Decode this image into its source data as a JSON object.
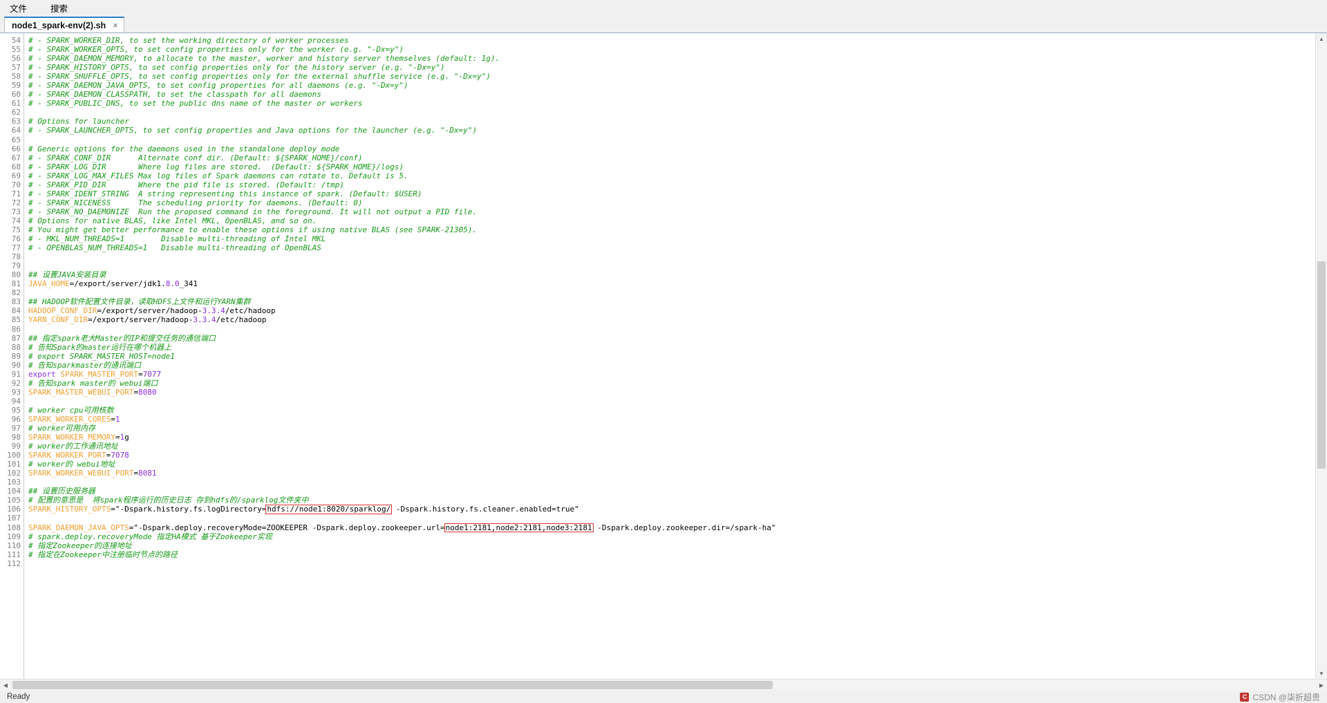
{
  "menubar": {
    "items": [
      {
        "label": "文件"
      },
      {
        "label": "搜索"
      }
    ]
  },
  "tab": {
    "title": "node1_spark-env(2).sh",
    "close": "×"
  },
  "statusbar": {
    "left": "Ready",
    "watermark": "CSDN @柒折超贵",
    "watermark_logo": "C"
  },
  "colors": {
    "comment": "#179a18",
    "variable": "#f0a030",
    "number": "#8a2be2",
    "keyword": "#8a2be2",
    "highlight_box": "#e03030",
    "tab_accent": "#2a7fd4",
    "gutter_text": "#808080"
  },
  "editor": {
    "first_line": 54,
    "lines": [
      {
        "n": 54,
        "segments": [
          {
            "t": "# - SPARK_WORKER_DIR, to set the working directory of worker processes",
            "c": "cmt"
          }
        ]
      },
      {
        "n": 55,
        "segments": [
          {
            "t": "# - SPARK_WORKER_OPTS, to set config properties only for the worker (e.g. \"-Dx=y\")",
            "c": "cmt"
          }
        ]
      },
      {
        "n": 56,
        "segments": [
          {
            "t": "# - SPARK_DAEMON_MEMORY, to allocate to the master, worker and history server themselves (default: 1g).",
            "c": "cmt"
          }
        ]
      },
      {
        "n": 57,
        "segments": [
          {
            "t": "# - SPARK_HISTORY_OPTS, to set config properties only for the history server (e.g. \"-Dx=y\")",
            "c": "cmt"
          }
        ]
      },
      {
        "n": 58,
        "segments": [
          {
            "t": "# - SPARK_SHUFFLE_OPTS, to set config properties only for the external shuffle service (e.g. \"-Dx=y\")",
            "c": "cmt"
          }
        ]
      },
      {
        "n": 59,
        "segments": [
          {
            "t": "# - SPARK_DAEMON_JAVA_OPTS, to set config properties for all daemons (e.g. \"-Dx=y\")",
            "c": "cmt"
          }
        ]
      },
      {
        "n": 60,
        "segments": [
          {
            "t": "# - SPARK_DAEMON_CLASSPATH, to set the classpath for all daemons",
            "c": "cmt"
          }
        ]
      },
      {
        "n": 61,
        "segments": [
          {
            "t": "# - SPARK_PUBLIC_DNS, to set the public dns name of the master or workers",
            "c": "cmt"
          }
        ]
      },
      {
        "n": 62,
        "segments": []
      },
      {
        "n": 63,
        "segments": [
          {
            "t": "# Options for launcher",
            "c": "cmt"
          }
        ]
      },
      {
        "n": 64,
        "segments": [
          {
            "t": "# - SPARK_LAUNCHER_OPTS, to set config properties and Java options for the launcher (e.g. \"-Dx=y\")",
            "c": "cmt"
          }
        ]
      },
      {
        "n": 65,
        "segments": []
      },
      {
        "n": 66,
        "segments": [
          {
            "t": "# Generic options for the daemons used in the standalone deploy mode",
            "c": "cmt"
          }
        ]
      },
      {
        "n": 67,
        "segments": [
          {
            "t": "# - SPARK_CONF_DIR      Alternate conf dir. (Default: ${SPARK_HOME}/conf)",
            "c": "cmt"
          }
        ]
      },
      {
        "n": 68,
        "segments": [
          {
            "t": "# - SPARK_LOG_DIR       Where log files are stored.  (Default: ${SPARK_HOME}/logs)",
            "c": "cmt"
          }
        ]
      },
      {
        "n": 69,
        "segments": [
          {
            "t": "# - SPARK_LOG_MAX_FILES Max log files of Spark daemons can rotate to. Default is 5.",
            "c": "cmt"
          }
        ]
      },
      {
        "n": 70,
        "segments": [
          {
            "t": "# - SPARK_PID_DIR       Where the pid file is stored. (Default: /tmp)",
            "c": "cmt"
          }
        ]
      },
      {
        "n": 71,
        "segments": [
          {
            "t": "# - SPARK_IDENT_STRING  A string representing this instance of spark. (Default: $USER)",
            "c": "cmt"
          }
        ]
      },
      {
        "n": 72,
        "segments": [
          {
            "t": "# - SPARK_NICENESS      The scheduling priority for daemons. (Default: 0)",
            "c": "cmt"
          }
        ]
      },
      {
        "n": 73,
        "segments": [
          {
            "t": "# - SPARK_NO_DAEMONIZE  Run the proposed command in the foreground. It will not output a PID file.",
            "c": "cmt"
          }
        ]
      },
      {
        "n": 74,
        "segments": [
          {
            "t": "# Options for native BLAS, like Intel MKL, OpenBLAS, and so on.",
            "c": "cmt"
          }
        ]
      },
      {
        "n": 75,
        "segments": [
          {
            "t": "# You might get better performance to enable these options if using native BLAS (see SPARK-21305).",
            "c": "cmt"
          }
        ]
      },
      {
        "n": 76,
        "segments": [
          {
            "t": "# - MKL_NUM_THREADS=1        Disable multi-threading of Intel MKL",
            "c": "cmt"
          }
        ]
      },
      {
        "n": 77,
        "segments": [
          {
            "t": "# - OPENBLAS_NUM_THREADS=1   Disable multi-threading of OpenBLAS",
            "c": "cmt"
          }
        ]
      },
      {
        "n": 78,
        "segments": []
      },
      {
        "n": 79,
        "segments": []
      },
      {
        "n": 80,
        "segments": [
          {
            "t": "## 设置JAVA安装目录",
            "c": "cmt"
          }
        ]
      },
      {
        "n": 81,
        "segments": [
          {
            "t": "JAVA_HOME",
            "c": "var"
          },
          {
            "t": "=/export/server/jdk1.",
            "c": "val"
          },
          {
            "t": "8.0",
            "c": "num"
          },
          {
            "t": "_341",
            "c": "val"
          }
        ]
      },
      {
        "n": 82,
        "segments": []
      },
      {
        "n": 83,
        "segments": [
          {
            "t": "## HADOOP软件配置文件目录，读取HDFS上文件和运行YARN集群",
            "c": "cmt"
          }
        ]
      },
      {
        "n": 84,
        "segments": [
          {
            "t": "HADOOP_CONF_DIR",
            "c": "var"
          },
          {
            "t": "=/export/server/hadoop-",
            "c": "val"
          },
          {
            "t": "3.3.4",
            "c": "num"
          },
          {
            "t": "/etc/hadoop",
            "c": "val"
          }
        ]
      },
      {
        "n": 85,
        "segments": [
          {
            "t": "YARN_CONF_DIR",
            "c": "var"
          },
          {
            "t": "=/export/server/hadoop-",
            "c": "val"
          },
          {
            "t": "3.3.4",
            "c": "num"
          },
          {
            "t": "/etc/hadoop",
            "c": "val"
          }
        ]
      },
      {
        "n": 86,
        "segments": []
      },
      {
        "n": 87,
        "segments": [
          {
            "t": "## 指定spark老大Master的IP和提交任务的通信端口",
            "c": "cmt"
          }
        ]
      },
      {
        "n": 88,
        "segments": [
          {
            "t": "# 告知Spark的master运行在哪个机器上",
            "c": "cmt"
          }
        ]
      },
      {
        "n": 89,
        "segments": [
          {
            "t": "# export SPARK_MASTER_HOST=node1",
            "c": "cmt"
          }
        ]
      },
      {
        "n": 90,
        "segments": [
          {
            "t": "# 告知sparkmaster的通讯端口",
            "c": "cmt"
          }
        ]
      },
      {
        "n": 91,
        "segments": [
          {
            "t": "export",
            "c": "kw"
          },
          {
            "t": " ",
            "c": "val"
          },
          {
            "t": "SPARK_MASTER_PORT",
            "c": "var"
          },
          {
            "t": "=",
            "c": "val"
          },
          {
            "t": "7077",
            "c": "num"
          }
        ]
      },
      {
        "n": 92,
        "segments": [
          {
            "t": "# 告知spark master的 webui端口",
            "c": "cmt"
          }
        ]
      },
      {
        "n": 93,
        "segments": [
          {
            "t": "SPARK_MASTER_WEBUI_PORT",
            "c": "var"
          },
          {
            "t": "=",
            "c": "val"
          },
          {
            "t": "8080",
            "c": "num"
          }
        ]
      },
      {
        "n": 94,
        "segments": []
      },
      {
        "n": 95,
        "segments": [
          {
            "t": "# worker cpu可用核数",
            "c": "cmt"
          }
        ]
      },
      {
        "n": 96,
        "segments": [
          {
            "t": "SPARK_WORKER_CORES",
            "c": "var"
          },
          {
            "t": "=",
            "c": "val"
          },
          {
            "t": "1",
            "c": "num"
          }
        ]
      },
      {
        "n": 97,
        "segments": [
          {
            "t": "# worker可用内存",
            "c": "cmt"
          }
        ]
      },
      {
        "n": 98,
        "segments": [
          {
            "t": "SPARK_WORKER_MEMORY",
            "c": "var"
          },
          {
            "t": "=",
            "c": "val"
          },
          {
            "t": "1",
            "c": "num"
          },
          {
            "t": "g",
            "c": "val"
          }
        ]
      },
      {
        "n": 99,
        "segments": [
          {
            "t": "# worker的工作通讯地址",
            "c": "cmt"
          }
        ]
      },
      {
        "n": 100,
        "segments": [
          {
            "t": "SPARK_WORKER_PORT",
            "c": "var"
          },
          {
            "t": "=",
            "c": "val"
          },
          {
            "t": "7078",
            "c": "num"
          }
        ]
      },
      {
        "n": 101,
        "segments": [
          {
            "t": "# worker的 webui地址",
            "c": "cmt"
          }
        ]
      },
      {
        "n": 102,
        "segments": [
          {
            "t": "SPARK_WORKER_WEBUI_PORT",
            "c": "var"
          },
          {
            "t": "=",
            "c": "val"
          },
          {
            "t": "8081",
            "c": "num"
          }
        ]
      },
      {
        "n": 103,
        "segments": []
      },
      {
        "n": 104,
        "segments": [
          {
            "t": "## 设置历史服务器",
            "c": "cmt"
          }
        ]
      },
      {
        "n": 105,
        "segments": [
          {
            "t": "# 配置的意思是  将spark程序运行的历史日志 存到hdfs的/sparklog文件夹中",
            "c": "cmt"
          }
        ]
      },
      {
        "n": 106,
        "segments": [
          {
            "t": "SPARK_HISTORY_OPTS",
            "c": "var"
          },
          {
            "t": "=\"-Dspark.history.fs.logDirectory=",
            "c": "val"
          },
          {
            "t": "hdfs://node1:8020/sparklog/",
            "c": "val",
            "box": true
          },
          {
            "t": " -Dspark.history.fs.cleaner.enabled=true\"",
            "c": "val"
          }
        ]
      },
      {
        "n": 107,
        "segments": []
      },
      {
        "n": 108,
        "segments": [
          {
            "t": "SPARK_DAEMON_JAVA_OPTS",
            "c": "var"
          },
          {
            "t": "=\"-Dspark.deploy.recoveryMode=ZOOKEEPER -Dspark.deploy.zookeeper.url=",
            "c": "val"
          },
          {
            "t": "node1:2181,node2:2181,node3:2181",
            "c": "val",
            "box": true
          },
          {
            "t": " -Dspark.deploy.zookeeper.dir=/spark-ha\"",
            "c": "val"
          }
        ]
      },
      {
        "n": 109,
        "segments": [
          {
            "t": "# spark.deploy.recoveryMode 指定HA模式 基于Zookeeper实现",
            "c": "cmt"
          }
        ]
      },
      {
        "n": 110,
        "segments": [
          {
            "t": "# 指定Zookeeper的连接地址",
            "c": "cmt"
          }
        ]
      },
      {
        "n": 111,
        "segments": [
          {
            "t": "# 指定在Zookeeper中注册临时节点的路径",
            "c": "cmt"
          }
        ]
      },
      {
        "n": 112,
        "segments": []
      }
    ]
  },
  "scrollbars": {
    "v_up": "▲",
    "v_down": "▼",
    "h_left": "◀",
    "h_right": "▶"
  }
}
